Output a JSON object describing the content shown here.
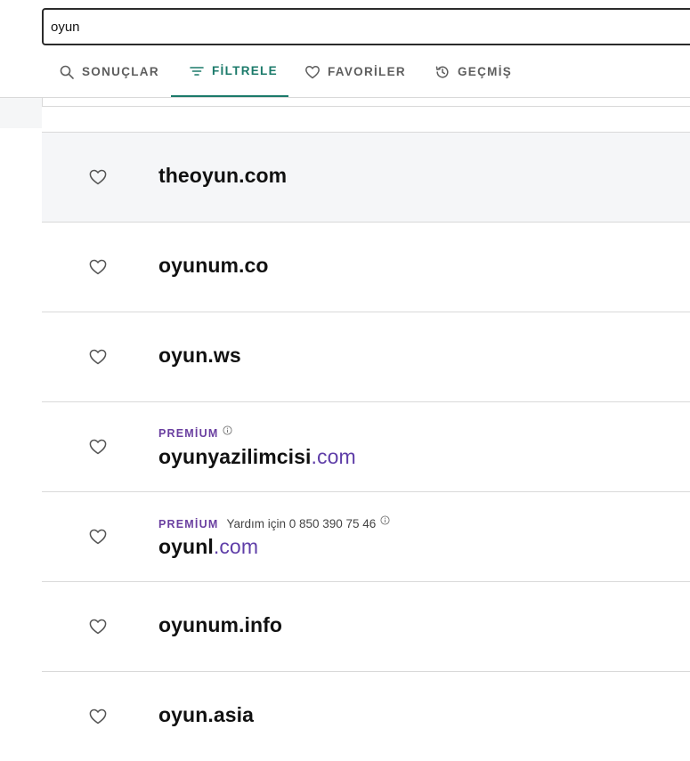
{
  "search": {
    "value": "oyun"
  },
  "tabs": [
    {
      "label": "SONUÇLAR",
      "icon": "search-icon",
      "active": false
    },
    {
      "label": "FİLTRELE",
      "icon": "filter-icon",
      "active": true
    },
    {
      "label": "FAVORİLER",
      "icon": "heart-icon",
      "active": false
    },
    {
      "label": "GEÇMİŞ",
      "icon": "history-icon",
      "active": false
    }
  ],
  "colors": {
    "accent": "#1b7a6a",
    "premium": "#6a3fa0",
    "tld": "#5f3ea8",
    "hover_row": "#f5f6f8"
  },
  "results": [
    {
      "name": "theoyun.com",
      "tld": ""
    },
    {
      "name": "oyunum.co",
      "tld": ""
    },
    {
      "name": "oyun.ws",
      "tld": ""
    },
    {
      "badge": "PREMİUM",
      "name": "oyunyazilimcisi",
      "tld": ".com"
    },
    {
      "badge": "PREMİUM",
      "help": "Yardım için 0 850 390 75 46",
      "name": "oyunl",
      "tld": ".com"
    },
    {
      "name": "oyunum.info",
      "tld": ""
    },
    {
      "name": "oyun.asia",
      "tld": ""
    }
  ]
}
